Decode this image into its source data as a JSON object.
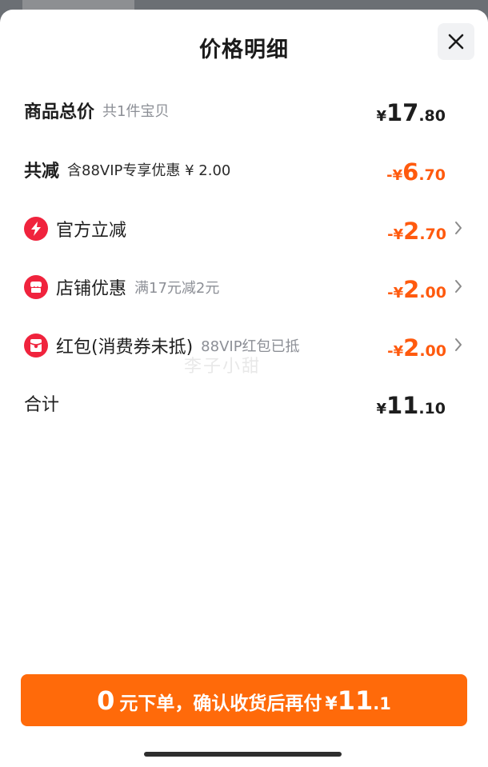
{
  "title": "价格明细",
  "rows": {
    "goods_total": {
      "label": "商品总价",
      "note": "共1件宝贝",
      "symbol": "¥",
      "int": "17",
      "dec": ".80"
    },
    "total_discount": {
      "label": "共减",
      "note": "含88VIP专享优惠 ¥ 2.00",
      "symbol": "-¥",
      "int": "6",
      "dec": ".70"
    },
    "official_discount": {
      "label": "官方立减",
      "icon": "lightning-icon",
      "symbol": "-¥",
      "int": "2",
      "dec": ".70"
    },
    "shop_discount": {
      "label": "店铺优惠",
      "note": "满17元减2元",
      "icon": "shop-icon",
      "symbol": "-¥",
      "int": "2",
      "dec": ".00"
    },
    "red_packet": {
      "label": "红包(消费券未抵)",
      "note": "88VIP红包已抵",
      "icon": "red-packet-icon",
      "symbol": "-¥",
      "int": "2",
      "dec": ".00"
    },
    "subtotal": {
      "label": "合计",
      "symbol": "¥",
      "int": "11",
      "dec": ".10"
    }
  },
  "watermark": "李子小甜",
  "pay_button": {
    "zero": "0",
    "text": "元下单，确认收货后再付",
    "symbol": "¥",
    "int": "11",
    "dec": ".1"
  },
  "colors": {
    "accent_orange": "#ff5a0e",
    "button_orange": "#ff6a0a",
    "icon_red": "#f0233d"
  }
}
